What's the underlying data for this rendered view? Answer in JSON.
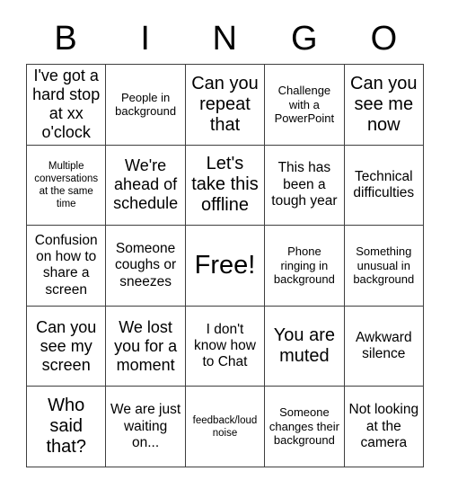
{
  "card": {
    "header_letters": [
      "B",
      "I",
      "N",
      "G",
      "O"
    ],
    "border_color": "#3f3f3f",
    "background_color": "#ffffff",
    "text_color": "#000000",
    "rows": [
      [
        {
          "text": "I've got a hard stop at xx o'clock",
          "size": "lg"
        },
        {
          "text": "People in background",
          "size": "sm"
        },
        {
          "text": "Can you repeat that",
          "size": "xl"
        },
        {
          "text": "Challenge with a PowerPoint",
          "size": "sm"
        },
        {
          "text": "Can you see me now",
          "size": "xl"
        }
      ],
      [
        {
          "text": "Multiple conversations at the same time",
          "size": "xs"
        },
        {
          "text": "We're ahead of schedule",
          "size": "lg"
        },
        {
          "text": "Let's take this offline",
          "size": "xl"
        },
        {
          "text": "This has been a tough year",
          "size": "md"
        },
        {
          "text": "Technical difficulties",
          "size": "md"
        }
      ],
      [
        {
          "text": "Confusion on how to share a screen",
          "size": "md"
        },
        {
          "text": "Someone coughs or sneezes",
          "size": "md"
        },
        {
          "text": "Free!",
          "size": "free"
        },
        {
          "text": "Phone ringing in background",
          "size": "sm"
        },
        {
          "text": "Something unusual in background",
          "size": "sm"
        }
      ],
      [
        {
          "text": "Can you see my screen",
          "size": "lg"
        },
        {
          "text": "We lost you for a moment",
          "size": "lg"
        },
        {
          "text": "I don't know how to Chat",
          "size": "md"
        },
        {
          "text": "You are muted",
          "size": "xl"
        },
        {
          "text": "Awkward silence",
          "size": "md"
        }
      ],
      [
        {
          "text": "Who said that?",
          "size": "xl"
        },
        {
          "text": "We are just waiting on...",
          "size": "md"
        },
        {
          "text": "feedback/loud noise",
          "size": "xs"
        },
        {
          "text": "Someone changes their background",
          "size": "sm"
        },
        {
          "text": "Not looking at the camera",
          "size": "md"
        }
      ]
    ]
  }
}
